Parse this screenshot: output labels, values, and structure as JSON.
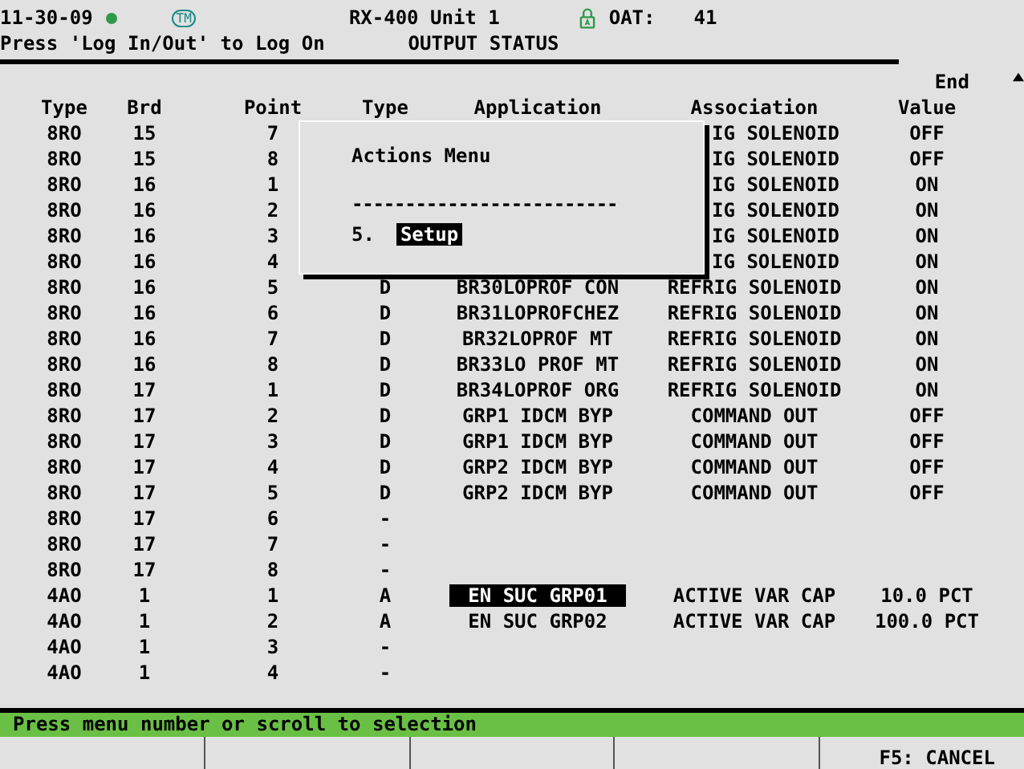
{
  "header": {
    "date": "11-30-09",
    "tm_badge": "TM",
    "unit": "RX-400 Unit 1",
    "oat_label": "OAT:",
    "oat_value": "41",
    "login_hint": "Press 'Log In/Out' to Log On",
    "screen_title": "OUTPUT STATUS"
  },
  "table": {
    "columns": [
      "Type",
      "Brd",
      "Point",
      "Type",
      "Application",
      "Association",
      "Value"
    ],
    "value_heading_top": "End",
    "rows": [
      {
        "type": "8RO",
        "brd": "15",
        "point": "7",
        "association": "IG SOLENOID",
        "value": "OFF",
        "selected": false
      },
      {
        "type": "8RO",
        "brd": "15",
        "point": "8",
        "association": "IG SOLENOID",
        "value": "OFF",
        "selected": false
      },
      {
        "type": "8RO",
        "brd": "16",
        "point": "1",
        "association": "IG SOLENOID",
        "value": "ON",
        "selected": false
      },
      {
        "type": "8RO",
        "brd": "16",
        "point": "2",
        "association": "IG SOLENOID",
        "value": "ON",
        "selected": false
      },
      {
        "type": "8RO",
        "brd": "16",
        "point": "3",
        "association": "IG SOLENOID",
        "value": "ON",
        "selected": false
      },
      {
        "type": "8RO",
        "brd": "16",
        "point": "4",
        "association": "IG SOLENOID",
        "value": "ON",
        "selected": false
      },
      {
        "type": "8RO",
        "brd": "16",
        "point": "5",
        "ptype": "D",
        "application": "BR30LOPROF CON",
        "association": "REFRIG SOLENOID",
        "value": "ON",
        "selected": false
      },
      {
        "type": "8RO",
        "brd": "16",
        "point": "6",
        "ptype": "D",
        "application": "BR31LOPROFCHEZ",
        "association": "REFRIG SOLENOID",
        "value": "ON",
        "selected": false
      },
      {
        "type": "8RO",
        "brd": "16",
        "point": "7",
        "ptype": "D",
        "application": "BR32LOPROF MT",
        "association": "REFRIG SOLENOID",
        "value": "ON",
        "selected": false
      },
      {
        "type": "8RO",
        "brd": "16",
        "point": "8",
        "ptype": "D",
        "application": "BR33LO PROF MT",
        "association": "REFRIG SOLENOID",
        "value": "ON",
        "selected": false
      },
      {
        "type": "8RO",
        "brd": "17",
        "point": "1",
        "ptype": "D",
        "application": "BR34LOPROF ORG",
        "association": "REFRIG SOLENOID",
        "value": "ON",
        "selected": false
      },
      {
        "type": "8RO",
        "brd": "17",
        "point": "2",
        "ptype": "D",
        "application": "GRP1 IDCM BYP",
        "association": "COMMAND OUT",
        "value": "OFF",
        "selected": false
      },
      {
        "type": "8RO",
        "brd": "17",
        "point": "3",
        "ptype": "D",
        "application": "GRP1 IDCM BYP",
        "association": "COMMAND OUT",
        "value": "OFF",
        "selected": false
      },
      {
        "type": "8RO",
        "brd": "17",
        "point": "4",
        "ptype": "D",
        "application": "GRP2 IDCM BYP",
        "association": "COMMAND OUT",
        "value": "OFF",
        "selected": false
      },
      {
        "type": "8RO",
        "brd": "17",
        "point": "5",
        "ptype": "D",
        "application": "GRP2 IDCM BYP",
        "association": "COMMAND OUT",
        "value": "OFF",
        "selected": false
      },
      {
        "type": "8RO",
        "brd": "17",
        "point": "6",
        "ptype": "-",
        "selected": false
      },
      {
        "type": "8RO",
        "brd": "17",
        "point": "7",
        "ptype": "-",
        "selected": false
      },
      {
        "type": "8RO",
        "brd": "17",
        "point": "8",
        "ptype": "-",
        "selected": false
      },
      {
        "type": "4AO",
        "brd": "1",
        "point": "1",
        "ptype": "A",
        "application": "EN SUC GRP01",
        "association": "ACTIVE VAR CAP",
        "value": "10.0 PCT",
        "selected": true
      },
      {
        "type": "4AO",
        "brd": "1",
        "point": "2",
        "ptype": "A",
        "application": "EN SUC GRP02",
        "association": "ACTIVE VAR CAP",
        "value": "100.0 PCT",
        "selected": false
      },
      {
        "type": "4AO",
        "brd": "1",
        "point": "3",
        "ptype": "-",
        "selected": false
      },
      {
        "type": "4AO",
        "brd": "1",
        "point": "4",
        "ptype": "-",
        "selected": false
      }
    ]
  },
  "actions_menu": {
    "title": "Actions Menu",
    "separator": "-------------------------",
    "items": [
      {
        "number": "5.",
        "label": "Setup",
        "selected": true
      }
    ]
  },
  "prompt": "Press menu number or scroll to selection",
  "function_keys": [
    {
      "label": "F5: CANCEL"
    }
  ]
}
